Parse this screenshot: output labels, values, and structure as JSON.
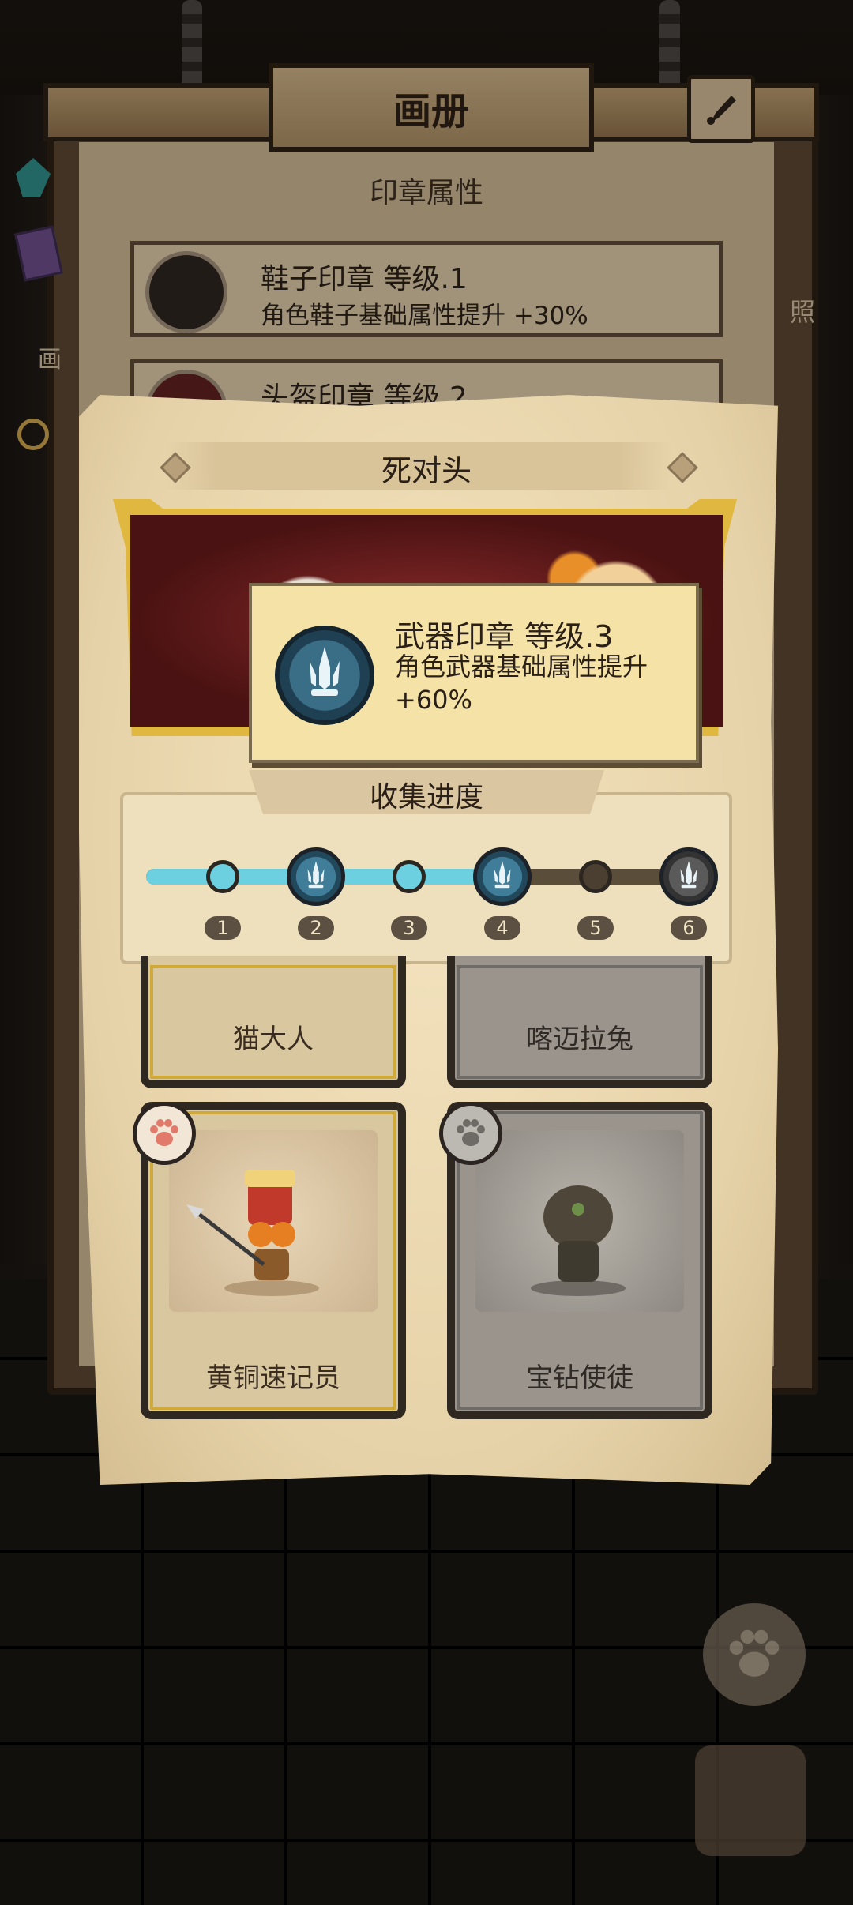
{
  "album": {
    "title": "画册",
    "section_title": "印章属性",
    "seals": [
      {
        "name": "鞋子印章 等级.1",
        "desc": "角色鞋子基础属性提升  +30%"
      },
      {
        "name": "头盔印章 等级.2",
        "desc": ""
      }
    ],
    "side_left_label": "画",
    "side_right_label": "照"
  },
  "modal": {
    "title": "死对头",
    "tooltip": {
      "name": "武器印章 等级.3",
      "desc": "角色武器基础属性提升 +60%"
    },
    "progress": {
      "title": "收集进度",
      "filled_fraction": 0.67,
      "nodes": [
        {
          "label": "1",
          "type": "dot",
          "active": true
        },
        {
          "label": "2",
          "type": "emblem",
          "active": true
        },
        {
          "label": "3",
          "type": "dot",
          "active": true
        },
        {
          "label": "4",
          "type": "emblem",
          "active": true
        },
        {
          "label": "5",
          "type": "dot",
          "active": false
        },
        {
          "label": "6",
          "type": "emblem",
          "active": false
        }
      ]
    },
    "cards": [
      {
        "name": "猫大人",
        "unlocked": true
      },
      {
        "name": "喀迈拉兔",
        "unlocked": false
      },
      {
        "name": "黄铜速记员",
        "unlocked": true
      },
      {
        "name": "宝钻使徒",
        "unlocked": false
      }
    ]
  },
  "colors": {
    "accent_cyan": "#6dd0e0",
    "gold_frame": "#e0b840",
    "parchment": "#f4e4c0"
  }
}
